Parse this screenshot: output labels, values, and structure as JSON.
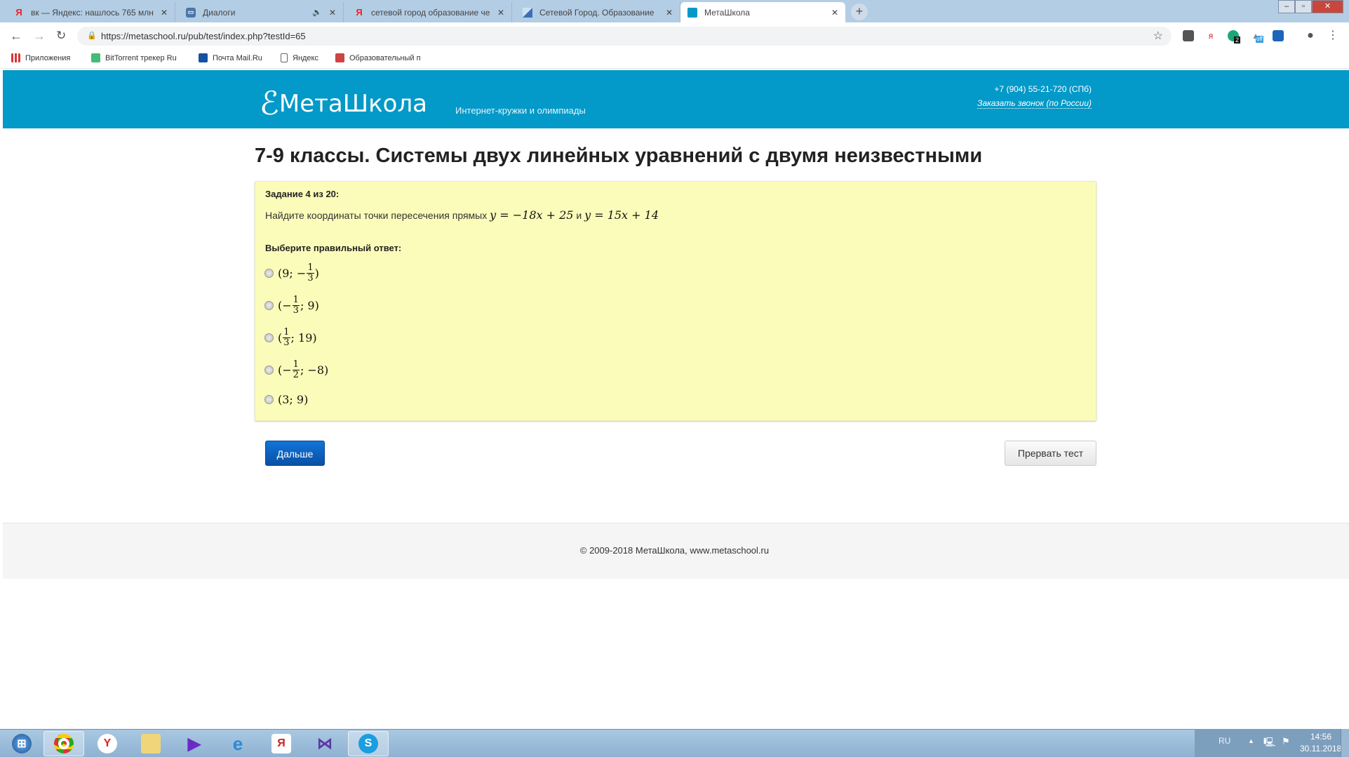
{
  "browser": {
    "tabs": [
      {
        "title": "вк — Яндекс: нашлось 765 млн",
        "icon": "yandex-icon"
      },
      {
        "title": "Диалоги",
        "icon": "vk-dialogs-icon"
      },
      {
        "title": "сетевой город образование че",
        "icon": "yandex-icon"
      },
      {
        "title": "Сетевой Город. Образование",
        "icon": "netcity-icon"
      },
      {
        "title": "МетаШкола",
        "icon": "metaschool-icon"
      }
    ],
    "url": "https://metaschool.ru/pub/test/index.php?testId=65",
    "extension_badges": {
      "badge1": "2",
      "badge2": "off"
    },
    "bookmarks": [
      "Приложения",
      "BitTorrent трекер Ru",
      "Почта Mail.Ru",
      "Яндекс",
      "Образовательный п"
    ]
  },
  "site": {
    "logo": "МетаШкола",
    "slogan": "Интернет-кружки и олимпиады",
    "phone": "+7 (904) 55-21-720 (СПб)",
    "callback": "Заказать звонок (по России)",
    "brand_color": "#0399c8"
  },
  "test": {
    "title": "7-9 классы. Системы двух линейных уравнений с двумя неизвестными",
    "task_number": "Задание 4 из 20:",
    "question_text": "Найдите координаты точки пересечения прямых",
    "eq1": "y = −18x + 25",
    "conj": "и",
    "eq2": "y = 15x + 14",
    "choose_label": "Выберите правильный ответ:",
    "options": [
      {
        "pre": "(9; −",
        "num": "1",
        "den": "3",
        "post": ")"
      },
      {
        "pre": "(−",
        "num": "1",
        "den": "3",
        "post": "; 9)"
      },
      {
        "pre": "(",
        "num": "1",
        "den": "3",
        "post": "; 19)"
      },
      {
        "pre": "(−",
        "num": "1",
        "den": "2",
        "post": "; −8)"
      },
      {
        "pre": "(3; 9)",
        "num": null,
        "den": null,
        "post": ""
      }
    ],
    "next_button": "Дальше",
    "abort_button": "Прервать тест"
  },
  "footer": {
    "copyright": "© 2009-2018 МетаШкола, www.metaschool.ru"
  },
  "taskbar": {
    "lang": "RU",
    "time": "14:56",
    "date": "30.11.2018"
  }
}
